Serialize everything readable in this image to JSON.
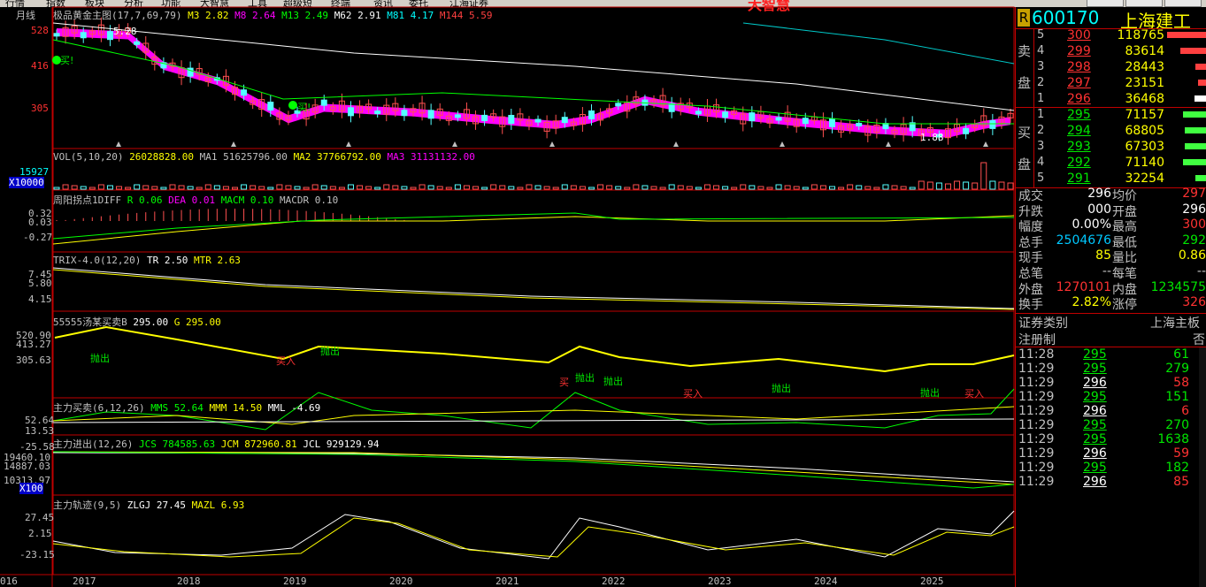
{
  "menu": [
    "行情",
    "指数",
    "板块",
    "分析",
    "功能",
    "大智慧",
    "工具",
    "超级短",
    "终端",
    "资讯",
    "委托",
    "江海证券"
  ],
  "brand": "大智慧",
  "chart": {
    "period_label": "月线",
    "main_indicator": {
      "name": "极品黄金主图(17,7,69,79)",
      "m3": "M3 2.82",
      "m8": "M8 2.64",
      "m13": "M13 2.49",
      "m62": "M62 2.91",
      "m81": "M81 4.17",
      "m144": "M144 5.59"
    },
    "price_axis": [
      "528",
      "416",
      "305"
    ],
    "price_high_label": "5.28",
    "price_low_label": "1.88",
    "buy_tags": [
      "买!",
      "买!"
    ],
    "vol_header": {
      "name": "VOL(5,10,20)",
      "vol": "26028828.00",
      "ma1": "MA1 51625796.00",
      "ma2": "MA2 37766792.00",
      "ma3": "MA3 31131132.00"
    },
    "vol_axis": [
      "15927",
      "X10000"
    ],
    "macd_header": {
      "name": "周阳拐点1DIFF",
      "diff": "R 0.06",
      "dea": "DEA 0.01",
      "macm": "MACM 0.10",
      "macdr": "MACDR 0.10"
    },
    "macd_axis": [
      "0.32",
      "0.03",
      "-0.27"
    ],
    "trix_header": {
      "name": "TRIX-4.0(12,20)",
      "tr": "TR 2.50",
      "mtr": "MTR 2.63"
    },
    "trix_axis": [
      "7.45",
      "5.80",
      "4.15"
    ],
    "tang_header": {
      "name": "55555汤某买卖B",
      "b": "295.00",
      "g": "G 295.00"
    },
    "tang_axis": [
      "520.90",
      "413.27",
      "305.63"
    ],
    "tang_tags": [
      "抛出",
      "买入",
      "抛出",
      "买",
      "抛出",
      "抛出",
      "买入",
      "抛出",
      "抛出",
      "买入"
    ],
    "zlmm_header": {
      "name": "主力买卖(6,12,26)",
      "mms": "MMS 52.64",
      "mmm": "MMM 14.50",
      "mml": "MML -4.69"
    },
    "zlmm_axis": [
      "52.64",
      "13.53",
      "-25.58"
    ],
    "zljc_header": {
      "name": "主力进出(12,26)",
      "jcs": "JCS 784585.63",
      "jcm": "JCM 872960.81",
      "jcl": "JCL 929129.94"
    },
    "zljc_axis": [
      "19460.10",
      "14887.03",
      "10313.97",
      "X100"
    ],
    "zlgj_header": {
      "name": "主力轨迹(9,5)",
      "zlgj": "ZLGJ 27.45",
      "mazl": "MAZL 6.93"
    },
    "zlgj_axis": [
      "27.45",
      "2.15",
      "-23.15"
    ],
    "x_axis": [
      "016",
      "2017",
      "2018",
      "2019",
      "2020",
      "2021",
      "2022",
      "2023",
      "2024",
      "2025"
    ]
  },
  "quote": {
    "badge": "R",
    "code": "600170",
    "name": "上海建工",
    "sell_label": [
      "卖",
      "盘"
    ],
    "buy_label": [
      "买",
      "盘"
    ],
    "asks": [
      {
        "lvl": "5",
        "price": "300",
        "vol": "118765",
        "bar": 0.75
      },
      {
        "lvl": "4",
        "price": "299",
        "vol": "83614",
        "bar": 0.5
      },
      {
        "lvl": "3",
        "price": "298",
        "vol": "28443",
        "bar": 0.2
      },
      {
        "lvl": "2",
        "price": "297",
        "vol": "23151",
        "bar": 0.15
      },
      {
        "lvl": "1",
        "price": "296",
        "vol": "36468",
        "bar": 0.22
      }
    ],
    "bids": [
      {
        "lvl": "1",
        "price": "295",
        "vol": "71157",
        "bar": 0.45
      },
      {
        "lvl": "2",
        "price": "294",
        "vol": "68805",
        "bar": 0.42
      },
      {
        "lvl": "3",
        "price": "293",
        "vol": "67303",
        "bar": 0.41
      },
      {
        "lvl": "4",
        "price": "292",
        "vol": "71140",
        "bar": 0.45
      },
      {
        "lvl": "5",
        "price": "291",
        "vol": "32254",
        "bar": 0.2
      }
    ],
    "stats": [
      {
        "l1": "成交",
        "v1": "296",
        "c1": "white",
        "l2": "均价",
        "v2": "297",
        "c2": "red"
      },
      {
        "l1": "升跌",
        "v1": "000",
        "c1": "white",
        "l2": "开盘",
        "v2": "296",
        "c2": "white"
      },
      {
        "l1": "幅度",
        "v1": "0.00%",
        "c1": "white",
        "l2": "最高",
        "v2": "300",
        "c2": "red"
      },
      {
        "l1": "总手",
        "v1": "2504676",
        "c1": "cyan",
        "l2": "最低",
        "v2": "292",
        "c2": "green"
      },
      {
        "l1": "现手",
        "v1": "85",
        "c1": "yellow",
        "l2": "量比",
        "v2": "0.86",
        "c2": "yellow"
      },
      {
        "l1": "总笔",
        "v1": "--",
        "c1": "gray",
        "l2": "每笔",
        "v2": "--",
        "c2": "gray"
      },
      {
        "l1": "外盘",
        "v1": "1270101",
        "c1": "red",
        "l2": "内盘",
        "v2": "1234575",
        "c2": "green"
      },
      {
        "l1": "换手",
        "v1": "2.82%",
        "c1": "yellow",
        "l2": "涨停",
        "v2": "326",
        "c2": "red"
      }
    ],
    "category_label": "证券类别",
    "category_value": "上海主板",
    "reg_label": "注册制",
    "reg_value": "否",
    "ticks": [
      {
        "t": "11:28",
        "p": "295",
        "pc": "green",
        "v": "61",
        "vc": "green"
      },
      {
        "t": "11:29",
        "p": "295",
        "pc": "green",
        "v": "279",
        "vc": "green"
      },
      {
        "t": "11:29",
        "p": "296",
        "pc": "white",
        "v": "58",
        "vc": "red"
      },
      {
        "t": "11:29",
        "p": "295",
        "pc": "green",
        "v": "151",
        "vc": "green"
      },
      {
        "t": "11:29",
        "p": "296",
        "pc": "white",
        "v": "6",
        "vc": "red"
      },
      {
        "t": "11:29",
        "p": "295",
        "pc": "green",
        "v": "270",
        "vc": "green"
      },
      {
        "t": "11:29",
        "p": "295",
        "pc": "green",
        "v": "1638",
        "vc": "green"
      },
      {
        "t": "11:29",
        "p": "296",
        "pc": "white",
        "v": "59",
        "vc": "red"
      },
      {
        "t": "11:29",
        "p": "295",
        "pc": "green",
        "v": "182",
        "vc": "green"
      },
      {
        "t": "11:29",
        "p": "296",
        "pc": "white",
        "v": "85",
        "vc": "red"
      }
    ]
  }
}
